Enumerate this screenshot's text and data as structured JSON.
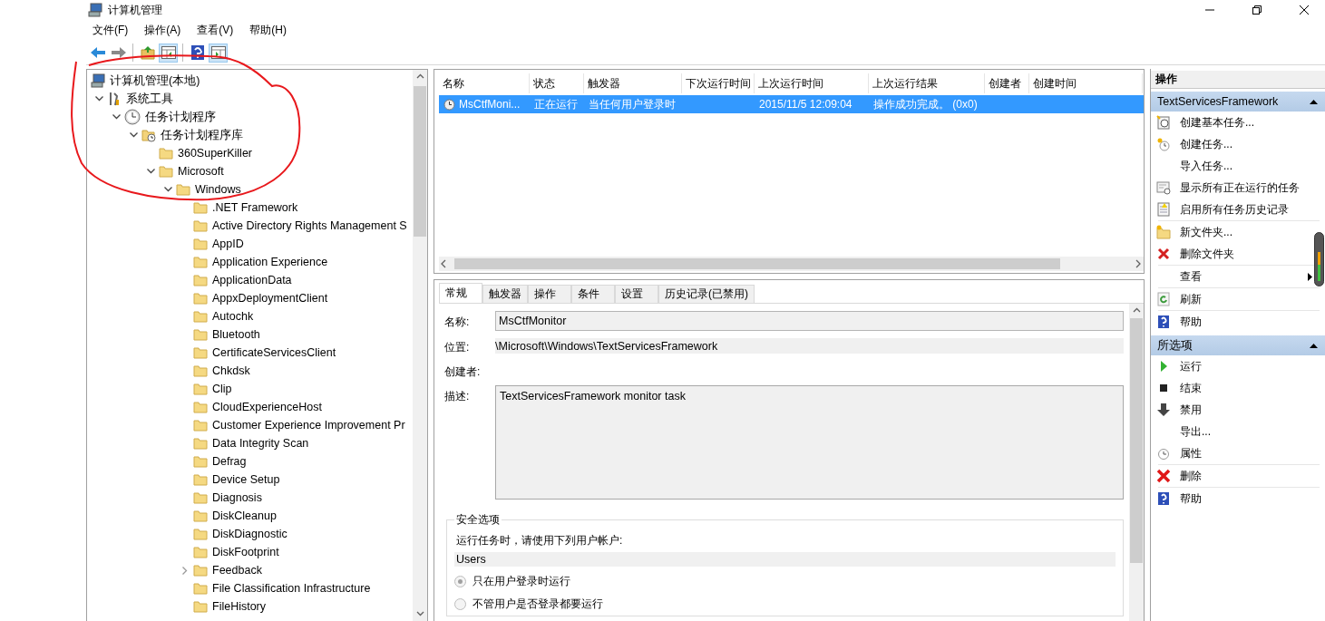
{
  "window": {
    "title": "计算机管理"
  },
  "menu": [
    "文件(F)",
    "操作(A)",
    "查看(V)",
    "帮助(H)"
  ],
  "toolbar": [
    {
      "kind": "back",
      "pressed": false,
      "disabled": false
    },
    {
      "kind": "forward",
      "pressed": false,
      "disabled": true
    },
    {
      "kind": "separator"
    },
    {
      "kind": "up",
      "pressed": false
    },
    {
      "kind": "console-tree",
      "pressed": true
    },
    {
      "kind": "separator"
    },
    {
      "kind": "help",
      "pressed": false
    },
    {
      "kind": "action-pane",
      "pressed": true
    }
  ],
  "tree": [
    {
      "label": "计算机管理(本地)",
      "kind": "computer",
      "children": [
        {
          "label": "系统工具",
          "kind": "tools",
          "expanded": true,
          "children": [
            {
              "label": "任务计划程序",
              "kind": "scheduler",
              "expanded": true,
              "children": [
                {
                  "label": "任务计划程序库",
                  "kind": "library",
                  "expanded": true,
                  "children": [
                    {
                      "label": "360SuperKiller",
                      "kind": "folder"
                    },
                    {
                      "label": "Microsoft",
                      "kind": "folder",
                      "expanded": true,
                      "children": [
                        {
                          "label": "Windows",
                          "kind": "folder",
                          "expanded": true,
                          "children": [
                            {
                              "label": ".NET Framework",
                              "kind": "folder"
                            },
                            {
                              "label": "Active Directory Rights Management S",
                              "kind": "folder"
                            },
                            {
                              "label": "AppID",
                              "kind": "folder"
                            },
                            {
                              "label": "Application Experience",
                              "kind": "folder"
                            },
                            {
                              "label": "ApplicationData",
                              "kind": "folder"
                            },
                            {
                              "label": "AppxDeploymentClient",
                              "kind": "folder"
                            },
                            {
                              "label": "Autochk",
                              "kind": "folder"
                            },
                            {
                              "label": "Bluetooth",
                              "kind": "folder"
                            },
                            {
                              "label": "CertificateServicesClient",
                              "kind": "folder"
                            },
                            {
                              "label": "Chkdsk",
                              "kind": "folder"
                            },
                            {
                              "label": "Clip",
                              "kind": "folder"
                            },
                            {
                              "label": "CloudExperienceHost",
                              "kind": "folder"
                            },
                            {
                              "label": "Customer Experience Improvement Pr",
                              "kind": "folder"
                            },
                            {
                              "label": "Data Integrity Scan",
                              "kind": "folder"
                            },
                            {
                              "label": "Defrag",
                              "kind": "folder"
                            },
                            {
                              "label": "Device Setup",
                              "kind": "folder"
                            },
                            {
                              "label": "Diagnosis",
                              "kind": "folder"
                            },
                            {
                              "label": "DiskCleanup",
                              "kind": "folder"
                            },
                            {
                              "label": "DiskDiagnostic",
                              "kind": "folder"
                            },
                            {
                              "label": "DiskFootprint",
                              "kind": "folder"
                            },
                            {
                              "label": "Feedback",
                              "kind": "folder",
                              "expanded": false
                            },
                            {
                              "label": "File Classification Infrastructure",
                              "kind": "folder"
                            },
                            {
                              "label": "FileHistory",
                              "kind": "folder"
                            }
                          ]
                        }
                      ]
                    }
                  ]
                }
              ]
            }
          ]
        }
      ]
    }
  ],
  "table": {
    "columns": [
      "名称",
      "状态",
      "触发器",
      "下次运行时间",
      "上次运行时间",
      "上次运行结果",
      "创建者",
      "创建时间"
    ],
    "rows": [
      {
        "selected": true,
        "cells": [
          "MsCtfMoni...",
          "正在运行",
          "当任何用户登录时",
          null,
          "2015/11/5 12:09:04",
          "操作成功完成。 (0x0)",
          null,
          null
        ]
      }
    ]
  },
  "details": {
    "tabs": [
      {
        "label": "常规",
        "selected": true
      },
      {
        "label": "触发器",
        "selected": false
      },
      {
        "label": "操作",
        "selected": false
      },
      {
        "label": "条件",
        "selected": false
      },
      {
        "label": "设置",
        "selected": false
      },
      {
        "label": "历史记录(已禁用)",
        "selected": false
      }
    ],
    "name_label": "名称:",
    "name_value": "MsCtfMonitor",
    "location_label": "位置:",
    "location_value": "\\Microsoft\\Windows\\TextServicesFramework",
    "author_label": "创建者:",
    "description_label": "描述:",
    "description_value": "TextServicesFramework monitor task",
    "security": {
      "title": "安全选项",
      "prompt": "运行任务时，请使用下列用户帐户:",
      "account": "Users",
      "options": [
        {
          "label": "只在用户登录时运行",
          "selected": true
        },
        {
          "label": "不管用户是否登录都要运行",
          "selected": false
        }
      ]
    }
  },
  "actions": {
    "title": "操作",
    "sections": [
      {
        "title": "TextServicesFramework",
        "expanded": true,
        "groups": [
          [
            {
              "label": "创建基本任务...",
              "kind": "basic-task"
            },
            {
              "label": "创建任务...",
              "kind": "task"
            },
            {
              "label": "导入任务...",
              "kind": "none"
            },
            {
              "label": "显示所有正在运行的任务",
              "kind": "running"
            },
            {
              "label": "启用所有任务历史记录",
              "kind": "history"
            }
          ],
          [
            {
              "label": "新文件夹...",
              "kind": "new-folder"
            },
            {
              "label": "删除文件夹",
              "kind": "delete"
            }
          ],
          [
            {
              "label": "查看",
              "kind": "none",
              "submenu": true
            }
          ],
          [
            {
              "label": "刷新",
              "kind": "refresh"
            }
          ],
          [
            {
              "label": "帮助",
              "kind": "help"
            }
          ]
        ]
      },
      {
        "title": "所选项",
        "expanded": true,
        "groups": [
          [
            {
              "label": "运行",
              "kind": "run"
            },
            {
              "label": "结束",
              "kind": "stop"
            },
            {
              "label": "禁用",
              "kind": "disable"
            },
            {
              "label": "导出...",
              "kind": "none"
            },
            {
              "label": "属性",
              "kind": "properties"
            }
          ],
          [
            {
              "label": "删除",
              "kind": "delete-big"
            }
          ],
          [
            {
              "label": "帮助",
              "kind": "help"
            }
          ]
        ]
      }
    ]
  }
}
